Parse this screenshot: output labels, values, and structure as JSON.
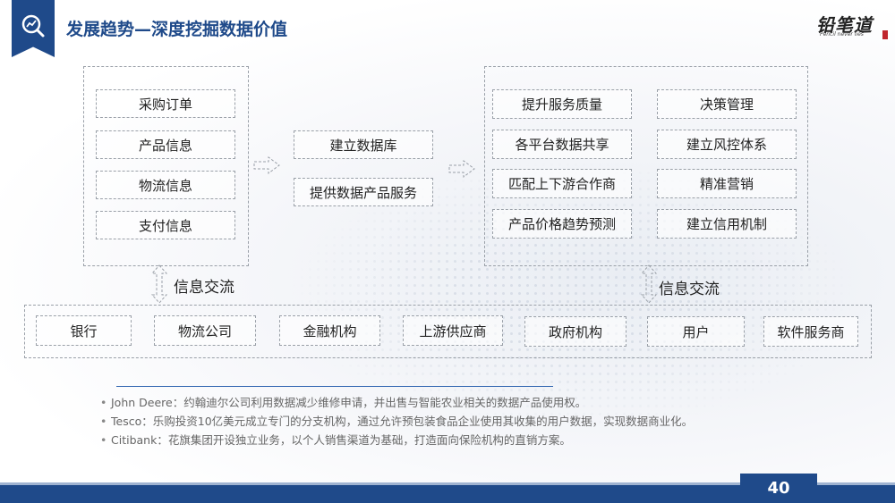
{
  "header": {
    "title": "发展趋势—深度挖掘数据价值",
    "badge_icon": "search-chart-icon",
    "logo_text": "铅笔道",
    "logo_subtitle": "Pencil never lies"
  },
  "sources": [
    "采购订单",
    "产品信息",
    "物流信息",
    "支付信息"
  ],
  "middle": [
    "建立数据库",
    "提供数据产品服务"
  ],
  "outcomes_left": [
    "提升服务质量",
    "各平台数据共享",
    "匹配上下游合作商",
    "产品价格趋势预测"
  ],
  "outcomes_right": [
    "决策管理",
    "建立风控体系",
    "精准营销",
    "建立信用机制"
  ],
  "exchange_left": "信息交流",
  "exchange_right": "信息交流",
  "entities": [
    "银行",
    "物流公司",
    "金融机构",
    "上游供应商",
    "政府机构",
    "用户",
    "软件服务商"
  ],
  "bullets": [
    "John Deere：约翰迪尔公司利用数据减少维修申请，并出售与智能农业相关的数据产品使用权。",
    "Tesco：乐购投资10亿美元成立专门的分支机构，通过允许预包装食品企业使用其收集的用户数据，实现数据商业化。",
    "Citibank：花旗集团开设独立业务，以个人销售渠道为基础，打造面向保险机构的直销方案。"
  ],
  "page_number": "40",
  "colors": {
    "primary": "#1f4a8a",
    "accent_red": "#c0262d"
  }
}
